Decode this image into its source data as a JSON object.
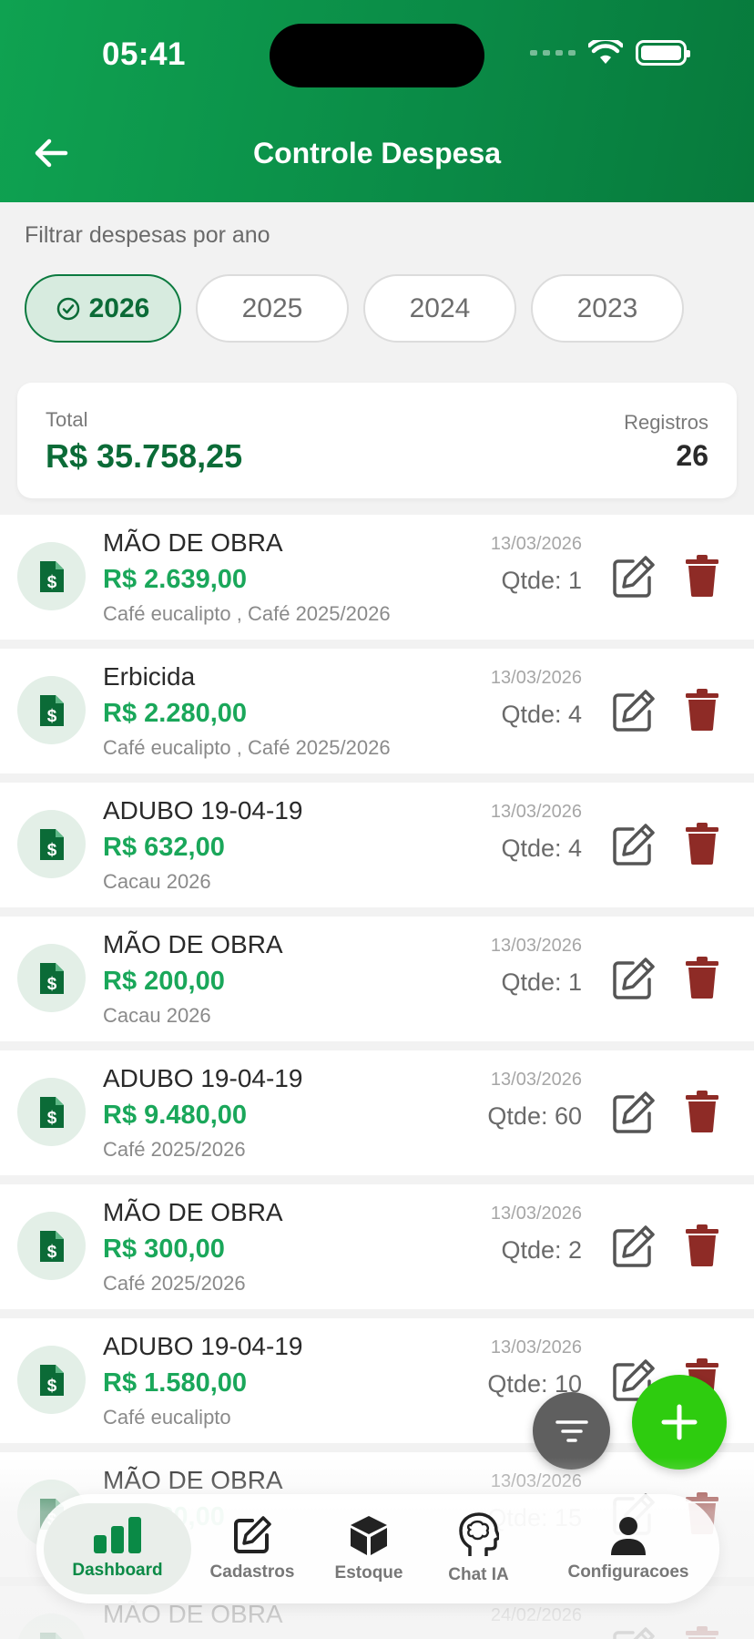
{
  "status_bar": {
    "time": "05:41"
  },
  "header": {
    "title": "Controle Despesa"
  },
  "filter": {
    "label": "Filtrar despesas por ano",
    "years": [
      "2026",
      "2025",
      "2024",
      "2023"
    ],
    "selected": "2026"
  },
  "summary": {
    "total_label": "Total",
    "total_value": "R$ 35.758,25",
    "records_label": "Registros",
    "records_value": "26"
  },
  "expenses": [
    {
      "name": "MÃO DE OBRA",
      "amount": "R$ 2.639,00",
      "categories": "Café eucalipto , Café 2025/2026",
      "date": "13/03/2026",
      "qty": "Qtde: 1"
    },
    {
      "name": "Erbicida",
      "amount": "R$ 2.280,00",
      "categories": "Café eucalipto , Café 2025/2026",
      "date": "13/03/2026",
      "qty": "Qtde: 4"
    },
    {
      "name": "ADUBO 19-04-19",
      "amount": "R$ 632,00",
      "categories": "Cacau 2026",
      "date": "13/03/2026",
      "qty": "Qtde: 4"
    },
    {
      "name": "MÃO DE OBRA",
      "amount": "R$ 200,00",
      "categories": "Cacau 2026",
      "date": "13/03/2026",
      "qty": "Qtde: 1"
    },
    {
      "name": "ADUBO 19-04-19",
      "amount": "R$ 9.480,00",
      "categories": "Café 2025/2026",
      "date": "13/03/2026",
      "qty": "Qtde: 60"
    },
    {
      "name": "MÃO DE OBRA",
      "amount": "R$ 300,00",
      "categories": "Café 2025/2026",
      "date": "13/03/2026",
      "qty": "Qtde: 2"
    },
    {
      "name": "ADUBO 19-04-19",
      "amount": "R$ 1.580,00",
      "categories": "Café eucalipto",
      "date": "13/03/2026",
      "qty": "Qtde: 10"
    },
    {
      "name": "MÃO DE OBRA",
      "amount": "R$ 480,00",
      "categories": "",
      "date": "13/03/2026",
      "qty": "Qtde: 15"
    },
    {
      "name": "MÃO DE OBRA",
      "amount": "",
      "categories": "",
      "date": "24/02/2026",
      "qty": ""
    }
  ],
  "tabbar": {
    "items": [
      {
        "label": "Dashboard",
        "icon": "chart-bars-icon"
      },
      {
        "label": "Cadastros",
        "icon": "edit-icon"
      },
      {
        "label": "Estoque",
        "icon": "box-icon"
      },
      {
        "label": "Chat IA",
        "icon": "brain-head-icon"
      },
      {
        "label": "Configuracoes",
        "icon": "person-icon"
      }
    ],
    "active": "Dashboard"
  },
  "colors": {
    "header_start": "#0fa251",
    "header_end": "#077a3c",
    "amount_green": "#1aa75a",
    "total_green": "#0b6b37",
    "delete_red": "#8e2b26",
    "fab_add": "#2ecc0f",
    "fab_filter": "#5f5f5f"
  }
}
